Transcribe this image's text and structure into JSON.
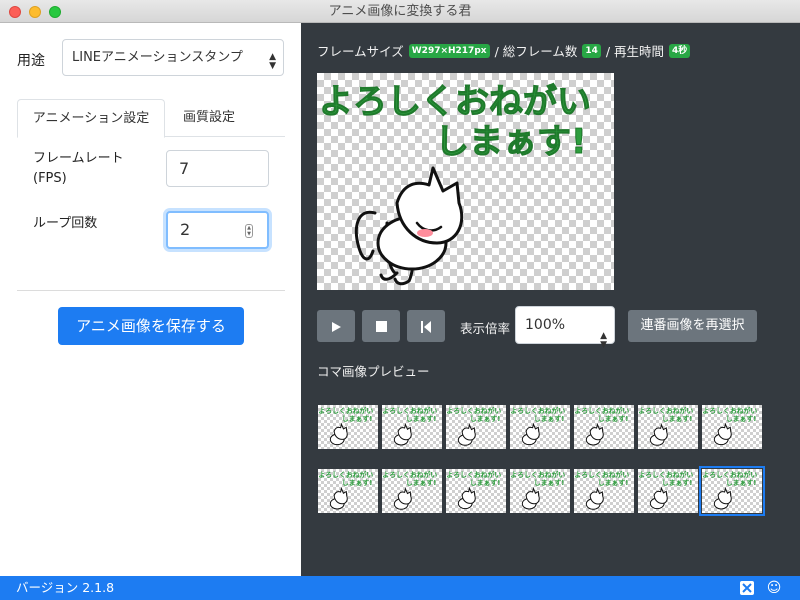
{
  "window": {
    "title": "アニメ画像に変換する君"
  },
  "left": {
    "usage_label": "用途",
    "usage_value": "LINEアニメーションスタンプ",
    "tabs": [
      {
        "label": "アニメーション設定",
        "active": true
      },
      {
        "label": "画質設定",
        "active": false
      }
    ],
    "fps_label_1": "フレームレート",
    "fps_label_2": "(FPS)",
    "fps_value": "7",
    "loop_label": "ループ回数",
    "loop_value": "2",
    "save_button": "アニメ画像を保存する"
  },
  "right": {
    "frame_size_label": "フレームサイズ",
    "frame_size_value": "W297×H217px",
    "total_frames_label": "/ 総フレーム数",
    "total_frames_value": "14",
    "play_time_label": "/ 再生時間",
    "play_time_value": "4秒",
    "sticker_text_line1": "よろしくおねがい",
    "sticker_text_line2": "しまぁす!",
    "zoom_label": "表示倍率",
    "zoom_value": "100%",
    "reselect_button": "連番画像を再選択",
    "frames_label": "コマ画像プレビュー",
    "thumbnails": [
      {
        "index": 1
      },
      {
        "index": 2
      },
      {
        "index": 3
      },
      {
        "index": 4
      },
      {
        "index": 5
      },
      {
        "index": 6
      },
      {
        "index": 7
      },
      {
        "index": 8
      },
      {
        "index": 9
      },
      {
        "index": 10
      },
      {
        "index": 11
      },
      {
        "index": 12
      },
      {
        "index": 13
      },
      {
        "index": 14,
        "selected": true
      }
    ]
  },
  "statusbar": {
    "version": "バージョン 2.1.8",
    "icons": [
      "app-logo-icon",
      "smiley-icon"
    ]
  },
  "colors": {
    "accent": "#1d7cf2",
    "panel_dark": "#343a40",
    "badge": "#28a745",
    "sticker_green": "#2e9e3e",
    "button_gray": "#6c757d"
  }
}
